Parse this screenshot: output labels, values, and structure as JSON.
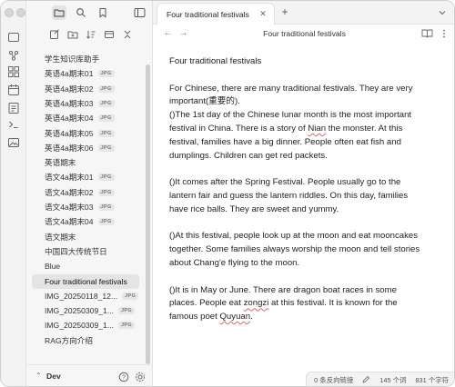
{
  "sidebar": {
    "files": [
      {
        "name": "学生知识库助手",
        "tag": ""
      },
      {
        "name": "英语4a期末01",
        "tag": "JPG"
      },
      {
        "name": "英语4a期末02",
        "tag": "JPG"
      },
      {
        "name": "英语4a期末03",
        "tag": "JPG"
      },
      {
        "name": "英语4a期末04",
        "tag": "JPG"
      },
      {
        "name": "英语4a期末05",
        "tag": "JPG"
      },
      {
        "name": "英语4a期末06",
        "tag": "JPG"
      },
      {
        "name": "英语期末",
        "tag": ""
      },
      {
        "name": "语文4a期末01",
        "tag": "JPG"
      },
      {
        "name": "语文4a期末02",
        "tag": "JPG"
      },
      {
        "name": "语文4a期末03",
        "tag": "JPG"
      },
      {
        "name": "语文4a期末04",
        "tag": "JPG"
      },
      {
        "name": "语文期末",
        "tag": ""
      },
      {
        "name": "中国四大传统节日",
        "tag": ""
      },
      {
        "name": "Blue",
        "tag": ""
      },
      {
        "name": "Four traditional festivals",
        "tag": "",
        "active": true
      },
      {
        "name": "IMG_20250118_12...",
        "tag": "JPG"
      },
      {
        "name": "IMG_20250309_1...",
        "tag": "JPG"
      },
      {
        "name": "IMG_20250309_1...",
        "tag": "JPG"
      },
      {
        "name": "RAG方向介绍",
        "tag": ""
      }
    ],
    "vault_name": "Dev"
  },
  "tabbar": {
    "active_tab": "Four traditional festivals",
    "close_symbol": "✕",
    "new_tab_symbol": "+"
  },
  "navbar": {
    "back_symbol": "←",
    "forward_symbol": "→",
    "view_title": "Four traditional festivals"
  },
  "document": {
    "title": "Four traditional festivals",
    "p1": "For Chinese, there are many traditional festivals. They are very important(重要的).",
    "p2a": "()The 1st day of the Chinese lunar month is the most important festival in China. There is a story of ",
    "p2_nian": "Nian",
    "p2b": " the monster. At this festival, families have a big dinner. People often eat fish and dumplings. Children can get red packets.",
    "p3": "()It comes after the Spring Festival. People usually go to the lantern fair and guess the lantern riddles. On this day, families have rice balls. They are sweet and yummy.",
    "p4": "()At this festival, people look up at the moon and eat mooncakes together. Some families always worship the moon and tell stories about Chang'e flying to the moon.",
    "p5a": "()It is in May or June. There are dragon boat races in some places. People eat ",
    "p5_zongzi": "zongzi",
    "p5b": " at this festival. It is known for the famous poet ",
    "p5_quyuan": "Quyuan",
    "p5c": "."
  },
  "statusbar": {
    "backlinks": "0 条反向链接",
    "words": "145 个词",
    "chars": "831 个字符"
  }
}
